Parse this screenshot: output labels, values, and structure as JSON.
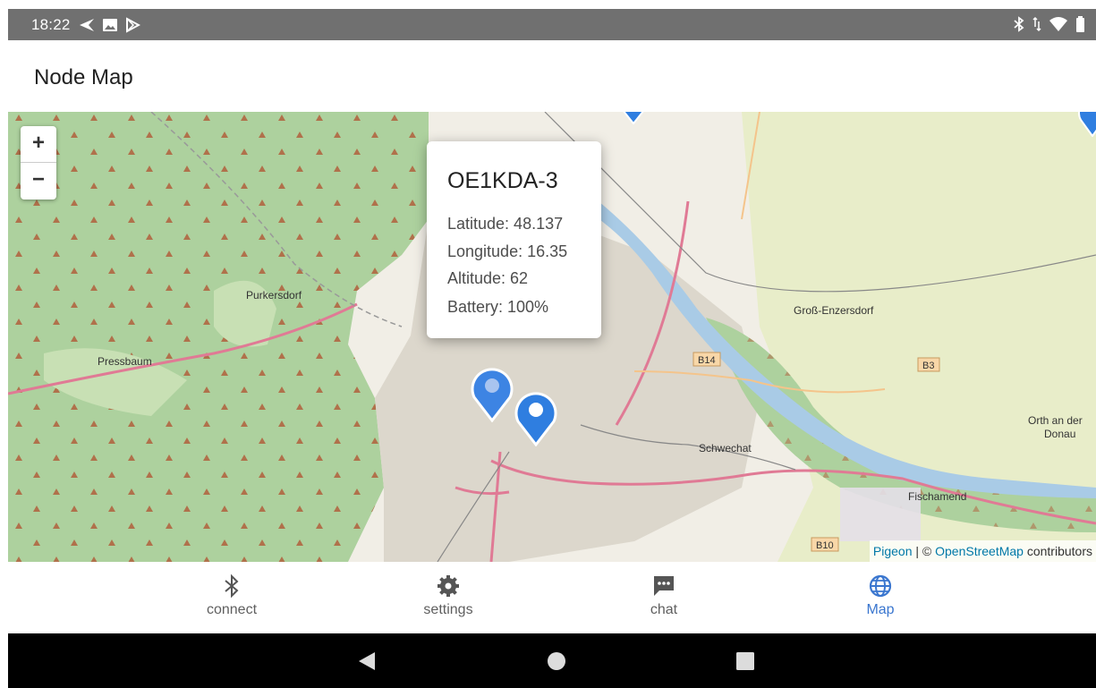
{
  "status_bar": {
    "time": "18:22"
  },
  "app_bar": {
    "title": "Node Map"
  },
  "map": {
    "zoom_in": "+",
    "zoom_out": "−",
    "popup": {
      "title": "OE1KDA-3",
      "latitude": "Latitude: 48.137",
      "longitude": "Longitude: 16.35",
      "altitude": "Altitude: 62",
      "battery": "Battery: 100%"
    },
    "places": {
      "purkersdorf": "Purkersdorf",
      "pressbaum": "Pressbaum",
      "gross_enzersdorf": "Groß-Enzersdorf",
      "schwechat": "Schwechat",
      "orth_line1": "Orth an der",
      "orth_line2": "Donau",
      "fischamend": "Fischamend"
    },
    "road_labels": {
      "b14": "B14",
      "b3": "B3",
      "b10": "B10"
    },
    "attribution": {
      "pigeon": "Pigeon",
      "separator": " | © ",
      "osm": "OpenStreetMap",
      "contributors": " contributors"
    },
    "colors": {
      "marker": "#2f7ee0",
      "motorway": "#e07a95",
      "water": "#a9cbe6",
      "forest": "#b5d59a"
    }
  },
  "bottom_nav": {
    "items": [
      {
        "label": "connect",
        "icon": "bluetooth-icon"
      },
      {
        "label": "settings",
        "icon": "gear-icon"
      },
      {
        "label": "chat",
        "icon": "chat-icon"
      },
      {
        "label": "Map",
        "icon": "globe-icon"
      }
    ],
    "active_color": "#3a76cf"
  }
}
